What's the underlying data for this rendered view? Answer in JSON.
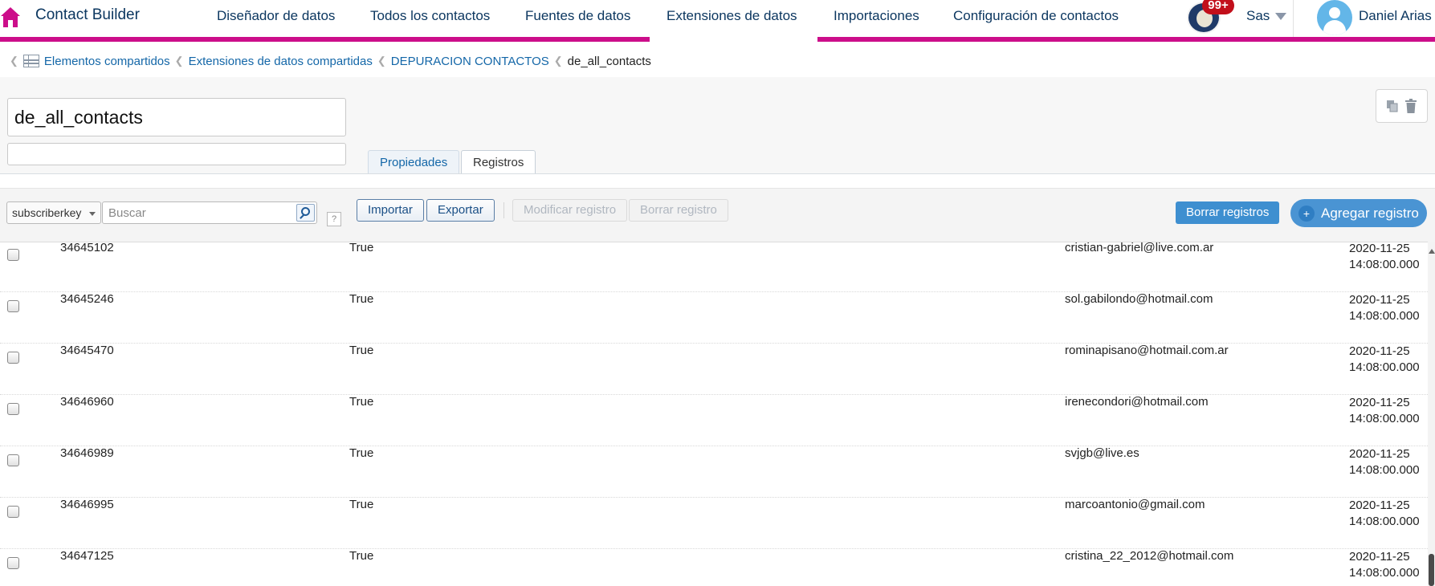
{
  "app": {
    "title": "Contact Builder"
  },
  "nav": {
    "items": [
      "Diseñador de datos",
      "Todos los contactos",
      "Fuentes de datos",
      "Extensiones de datos",
      "Importaciones",
      "Configuración de contactos"
    ],
    "active": "Extensiones de datos",
    "notification_count": "99+",
    "org": "Sas",
    "user": "Daniel Arias"
  },
  "breadcrumb": [
    "Elementos compartidos",
    "Extensiones de datos compartidas",
    "DEPURACION CONTACTOS",
    "de_all_contacts"
  ],
  "extension": {
    "name": "de_all_contacts",
    "description": ""
  },
  "tabs": [
    "Propiedades",
    "Registros"
  ],
  "toolbar": {
    "field_select": "subscriberkey",
    "search_placeholder": "Buscar",
    "help": "?",
    "import": "Importar",
    "export": "Exportar",
    "modify": "Modificar registro",
    "delete": "Borrar registro",
    "delete_all": "Borrar registros",
    "add": "Agregar registro",
    "add_icon": "+"
  },
  "rows": [
    {
      "id": "34645102",
      "flag": "True",
      "email": "cristian-gabriel@live.com.ar",
      "date": "2020-11-25 14:08:00.000"
    },
    {
      "id": "34645246",
      "flag": "True",
      "email": "sol.gabilondo@hotmail.com",
      "date": "2020-11-25 14:08:00.000"
    },
    {
      "id": "34645470",
      "flag": "True",
      "email": "rominapisano@hotmail.com.ar",
      "date": "2020-11-25 14:08:00.000"
    },
    {
      "id": "34646960",
      "flag": "True",
      "email": "irenecondori@hotmail.com",
      "date": "2020-11-25 14:08:00.000"
    },
    {
      "id": "34646989",
      "flag": "True",
      "email": "svjgb@live.es",
      "date": "2020-11-25 14:08:00.000"
    },
    {
      "id": "34646995",
      "flag": "True",
      "email": "marcoantonio@gmail.com",
      "date": "2020-11-25 14:08:00.000"
    },
    {
      "id": "34647125",
      "flag": "True",
      "email": "cristina_22_2012@hotmail.com",
      "date": "2020-11-25 14:08:00.000"
    }
  ],
  "colors": {
    "brand": "#cc0e8a",
    "link": "#1467a8",
    "primary": "#4a94d3"
  }
}
